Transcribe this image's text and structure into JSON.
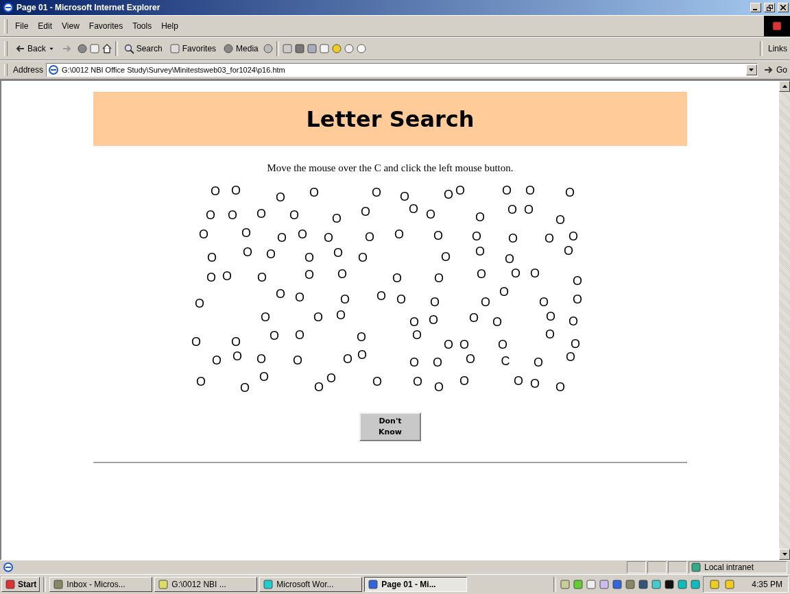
{
  "window": {
    "title": "Page 01 - Microsoft Internet Explorer"
  },
  "menu": [
    "File",
    "Edit",
    "View",
    "Favorites",
    "Tools",
    "Help"
  ],
  "toolbar": {
    "back": "Back",
    "search": "Search",
    "favorites": "Favorites",
    "media": "Media",
    "links": "Links"
  },
  "address": {
    "label": "Address",
    "value": "G:\\0012 NBI Office Study\\Survey\\Minitestsweb03_for1024\\p16.htm",
    "go": "Go"
  },
  "page": {
    "title": "Letter Search",
    "instruction": "Move the mouse over the C and click the left mouse button.",
    "letters": [
      "O",
      "O",
      "O",
      "O",
      "O",
      "O",
      "O",
      "O",
      "O",
      "O",
      "O",
      "O",
      "O",
      "O",
      "O",
      "O",
      "O",
      "O",
      "O",
      "O",
      "O",
      "O",
      "O",
      "O",
      "O",
      "O",
      "O",
      "O",
      "O",
      "O",
      "O",
      "O",
      "O",
      "O",
      "O",
      "O",
      "O",
      "O",
      "O",
      "O",
      "O",
      "O",
      "O",
      "O",
      "O",
      "O",
      "O",
      "O",
      "O",
      "O",
      "O",
      "O",
      "O",
      "O",
      "O",
      "O",
      "O",
      "O",
      "O",
      "O",
      "O",
      "O",
      "O",
      "O",
      "O",
      "O",
      "O",
      "O",
      "O",
      "O",
      "O",
      "O",
      "O",
      "O",
      "O",
      "O",
      "O",
      "O",
      "O",
      "O",
      "O",
      "O",
      "O",
      "O",
      "O",
      "O",
      "O",
      "O",
      "O",
      "O",
      "O",
      "O",
      "O",
      "O",
      "O",
      "O",
      "C",
      "O",
      "O",
      "O",
      "O",
      "O",
      "O",
      "O",
      "O",
      "O",
      "O",
      "O",
      "O",
      "O",
      "O"
    ],
    "button": "Don't Know"
  },
  "status_bar": {
    "zone": "Local intranet"
  },
  "taskbar": {
    "start": "Start",
    "tasks": [
      {
        "label": "Inbox - Micros...",
        "selected": false
      },
      {
        "label": "G:\\0012 NBI ...",
        "selected": false
      },
      {
        "label": "Microsoft Wor...",
        "selected": false
      },
      {
        "label": "Page 01 - Mi...",
        "selected": true
      }
    ],
    "clock": "4:35 PM"
  }
}
